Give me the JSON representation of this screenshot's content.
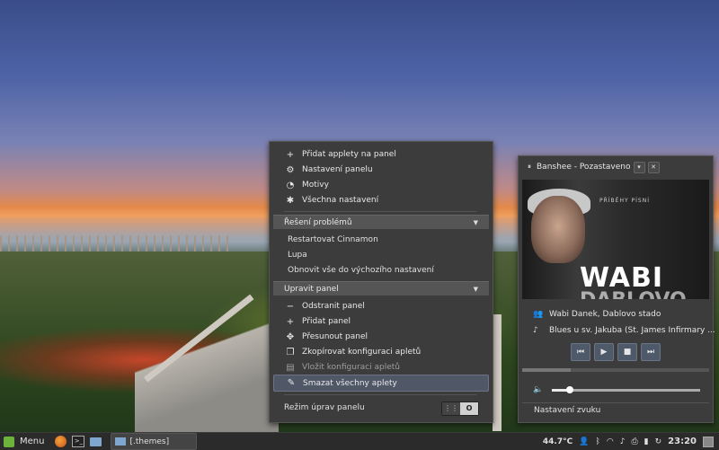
{
  "panel_menu": {
    "items_top": [
      {
        "icon": "plus-icon",
        "glyph": "+",
        "label": "Přidat applety na panel"
      },
      {
        "icon": "gear-icon",
        "glyph": "⚙",
        "label": "Nastavení panelu"
      },
      {
        "icon": "palette-icon",
        "glyph": "◔",
        "label": "Motivy"
      },
      {
        "icon": "settings-icon",
        "glyph": "✱",
        "label": "Všechna nastavení"
      }
    ],
    "troubleshoot": {
      "label": "Řešení problémů",
      "items": [
        "Restartovat Cinnamon",
        "Lupa",
        "Obnovit vše do výchozího nastavení"
      ]
    },
    "edit_panel": {
      "label": "Upravit panel",
      "items": [
        {
          "icon": "minus-icon",
          "glyph": "−",
          "label": "Odstranit panel"
        },
        {
          "icon": "plus-icon",
          "glyph": "+",
          "label": "Přidat panel"
        },
        {
          "icon": "move-icon",
          "glyph": "✥",
          "label": "Přesunout panel"
        },
        {
          "icon": "copy-icon",
          "glyph": "❐",
          "label": "Zkopírovat konfiguraci apletů"
        },
        {
          "icon": "paste-icon",
          "glyph": "▤",
          "label": "Vložit konfiguraci apletů"
        },
        {
          "icon": "broom-icon",
          "glyph": "✎",
          "label": "Smazat všechny aplety"
        }
      ]
    },
    "edit_mode": {
      "label": "Režim úprav panelu",
      "toggle_off": "⋮⋮",
      "toggle_on": "O"
    }
  },
  "sound": {
    "player_title": "Banshee - Pozastaveno",
    "cover": {
      "series": "PŘÍBĚHY PÍSNÍ",
      "title": "WABI",
      "title2": "DABLOVO"
    },
    "artist": "Wabi Danek, Dablovo stado",
    "track": "Blues u sv. Jakuba (St. James Infirmary ...",
    "controls": [
      "⏮",
      "▶",
      "■",
      "⏭"
    ],
    "progress": 0.26,
    "volume": 0.12,
    "settings_label": "Nastavení zvuku"
  },
  "taskbar": {
    "menu_label": "Menu",
    "window_label": "[.themes]",
    "temperature": "44.7°C",
    "time": "23:20"
  }
}
